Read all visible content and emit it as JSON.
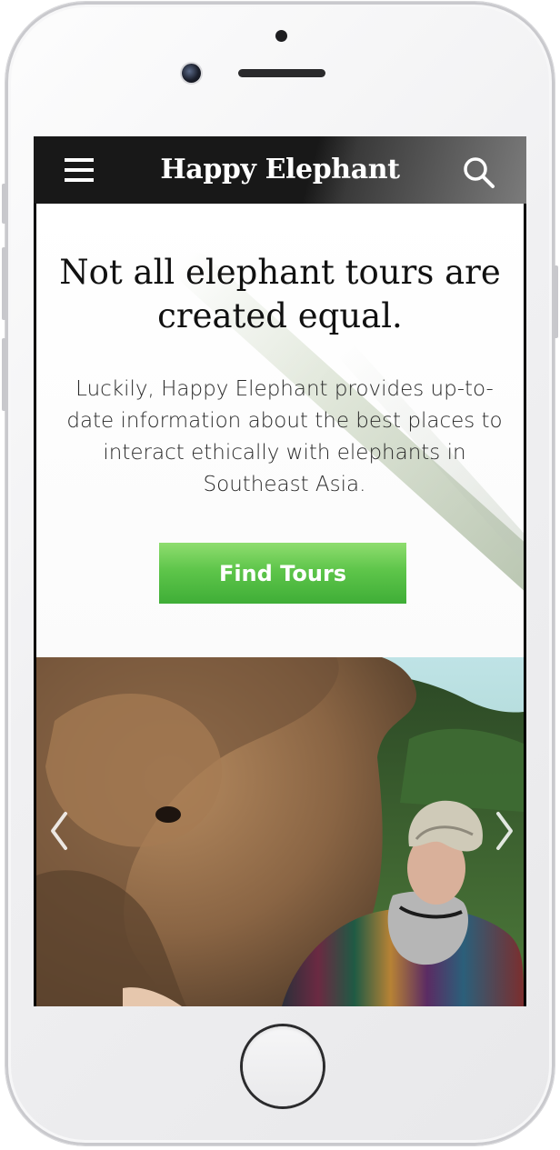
{
  "header": {
    "brand": "Happy Elephant",
    "menu_icon": "hamburger-icon",
    "search_icon": "search-icon"
  },
  "hero": {
    "headline": "Not all elephant tours are created equal.",
    "lead": "Luckily, Happy Elephant provides up-to-date information about the best places to interact ethically with elephants in Southeast Asia.",
    "cta_label": "Find Tours"
  },
  "carousel": {
    "prev_icon": "chevron-left-icon",
    "next_icon": "chevron-right-icon",
    "image_subject": ""
  },
  "colors": {
    "topbar": "#181818",
    "cta_green": "#5ec54a",
    "text": "#111111"
  }
}
